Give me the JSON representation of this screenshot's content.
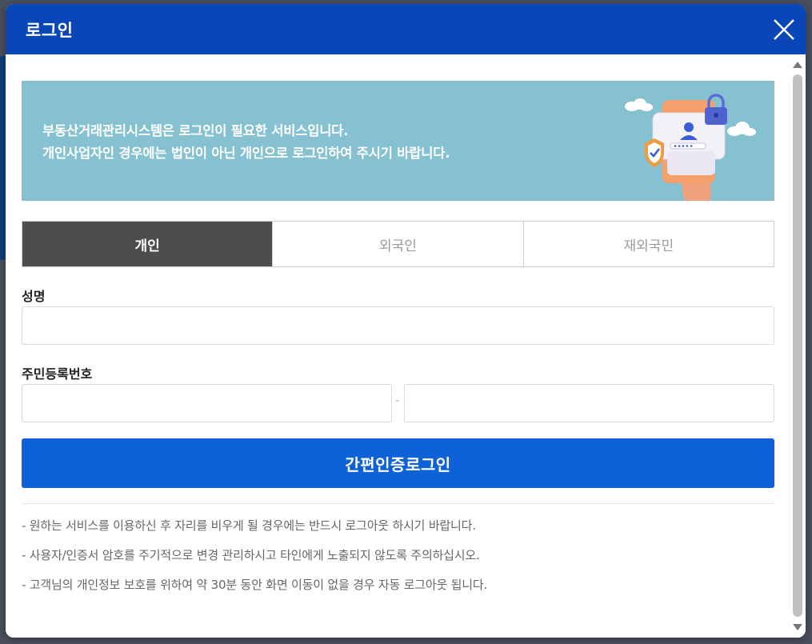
{
  "modal": {
    "title": "로그인",
    "close_icon": "close-icon"
  },
  "banner": {
    "line1": "부동산거래관리시스템은 로그인이 필요한 서비스입니다.",
    "line2": "개인사업자인 경우에는 법인이 아닌 개인으로 로그인하여 주시기 바랍니다."
  },
  "tabs": [
    {
      "label": "개인",
      "active": true
    },
    {
      "label": "외국인",
      "active": false
    },
    {
      "label": "재외국민",
      "active": false
    }
  ],
  "form": {
    "name_label": "성명",
    "name_value": "",
    "rrn_label": "주민등록번호",
    "rrn_front_value": "",
    "rrn_back_value": "",
    "rrn_separator": "-"
  },
  "login_button": "간편인증로그인",
  "notices": [
    "- 원하는 서비스를 이용하신 후 자리를 비우게 될 경우에는 반드시 로그아웃 하시기 바랍니다.",
    "- 사용자/인증서 암호를 주기적으로 변경 관리하시고 타인에게 노출되지 않도록 주의하십시오.",
    "- 고객님의 개인정보 보호를 위하여 약 30분 동안 화면 이동이 없을 경우 자동 로그아웃 됩니다."
  ],
  "colors": {
    "header": "#0a46b8",
    "banner": "#85c1d1",
    "active_tab": "#4d4d4d",
    "login_button": "#0e62d8"
  }
}
